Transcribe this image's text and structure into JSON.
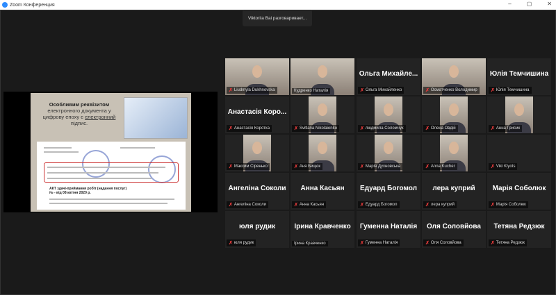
{
  "window": {
    "title": "Zoom Конференция",
    "minimize": "–",
    "maximize": "▢",
    "close": "✕"
  },
  "speaking_banner": "Viktoriia Bai разговаривает...",
  "shared_slide": {
    "title_bold": "Особливим реквізитом",
    "title_rest": "електронного документа у цифрову епоху є",
    "title_underlined": "електронний",
    "title_end": "підпис.",
    "act_line1": "АКТ здачі-приймання робіт (надання послуг)",
    "act_line2": "№ -    від 08 квітня 2020 р."
  },
  "participants": [
    {
      "name": "Liudmyla Dukhnovska",
      "video": "full",
      "muted": true
    },
    {
      "name": "Кудренко Наталія",
      "video": "full",
      "muted": false
    },
    {
      "name": "Ольга Михайленко",
      "display": "Ольга Михайле...",
      "muted": true
    },
    {
      "name": "Осматченко Володимир",
      "video": "full",
      "muted": true
    },
    {
      "name": "Юлія Темчишина",
      "display": "Юлія Темчишина",
      "muted": true
    },
    {
      "name": "Анастасія Коротка",
      "display": "Анастасія Коро...",
      "muted": true
    },
    {
      "name": "Svitlana Nikolaienko",
      "video": "narrow",
      "muted": true
    },
    {
      "name": "людмила Соломчук",
      "video": "narrow",
      "muted": true
    },
    {
      "name": "Олена Овдій",
      "video": "narrow",
      "muted": true
    },
    {
      "name": "Анна Грисик",
      "video": "narrow",
      "muted": true
    },
    {
      "name": "Максим Сіренько",
      "video": "narrow",
      "muted": true
    },
    {
      "name": "Аня Бицюк",
      "video": "narrow",
      "muted": true
    },
    {
      "name": "Марія Духновська",
      "video": "narrow",
      "muted": true
    },
    {
      "name": "Anna Kucher",
      "video": "narrow",
      "muted": true
    },
    {
      "name": "Viki Klyots",
      "muted": true
    },
    {
      "name": "Ангеліна Соколи",
      "display": "Ангеліна Соколи",
      "muted": true
    },
    {
      "name": "Анна Касьян",
      "display": "Анна Касьян",
      "muted": true
    },
    {
      "name": "Едуард Богомол",
      "display": "Едуард Богомол",
      "muted": true
    },
    {
      "name": "лера куприй",
      "display": "лера куприй",
      "muted": true
    },
    {
      "name": "Марія Соболюк",
      "display": "Марія Соболюк",
      "muted": true
    },
    {
      "name": "юля рудик",
      "display": "юля рудик",
      "muted": true
    },
    {
      "name": "Ірина Кравченко",
      "display": "Ірина Кравченко",
      "muted": false
    },
    {
      "name": "Гуменна Наталія",
      "display": "Гуменна Наталія",
      "muted": true
    },
    {
      "name": "Оля Соловйова",
      "display": "Оля Соловйова",
      "muted": true
    },
    {
      "name": "Тетяна Редзюк",
      "display": "Тетяна Редзюк",
      "muted": true
    }
  ],
  "colors": {
    "accent": "#2d8cff",
    "muted_icon": "#e03a3a",
    "tile_bg": "#232323"
  }
}
